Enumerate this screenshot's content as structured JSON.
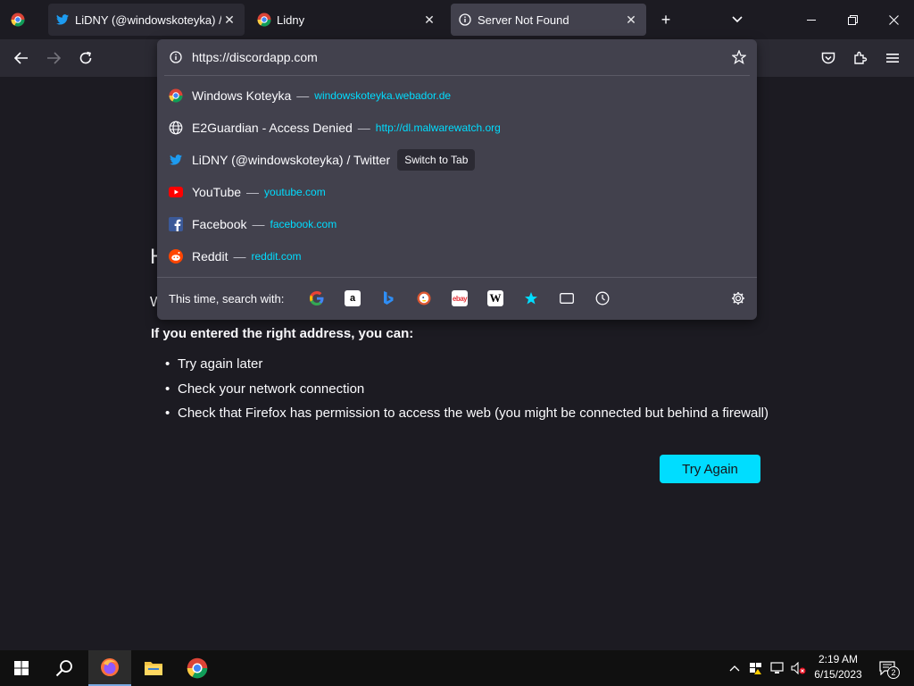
{
  "tabs": [
    {
      "title": "LiDNY (@windowskoteyka) / Twitter",
      "display": "LiDNY (@windowskoteyka) / Tw"
    },
    {
      "title": "Lidny"
    },
    {
      "title": "Server Not Found"
    }
  ],
  "urlbar": {
    "value": "https://discordapp.com"
  },
  "results": [
    {
      "title": "Windows Koteyka",
      "sep": "—",
      "url": "windowskoteyka.webador.de",
      "icon": "chrome-icon"
    },
    {
      "title": "E2Guardian - Access Denied",
      "sep": "—",
      "url": "http://dl.malwarewatch.org",
      "icon": "globe-icon"
    },
    {
      "title": "LiDNY (@windowskoteyka) / Twitter",
      "action": "Switch to Tab",
      "icon": "twitter-icon"
    },
    {
      "title": "YouTube",
      "sep": "—",
      "url": "youtube.com",
      "icon": "youtube-icon"
    },
    {
      "title": "Facebook",
      "sep": "—",
      "url": "facebook.com",
      "icon": "facebook-icon"
    },
    {
      "title": "Reddit",
      "sep": "—",
      "url": "reddit.com",
      "icon": "reddit-icon"
    }
  ],
  "search_with": {
    "label": "This time, search with:",
    "engines": [
      "google-icon",
      "amazon-icon",
      "bing-icon",
      "duckduckgo-icon",
      "ebay-icon",
      "wikipedia-icon",
      "bookmarks-icon",
      "tabs-icon",
      "history-icon"
    ]
  },
  "page": {
    "heading_fragment": "H",
    "para_fragment": "W",
    "entered": "If you entered the right address, you can:",
    "items": [
      "Try again later",
      "Check your network connection",
      "Check that Firefox has permission to access the web (you might be connected but behind a firewall)"
    ],
    "try_again": "Try Again"
  },
  "clock": {
    "time": "2:19 AM",
    "date": "6/15/2023"
  },
  "notifications": {
    "count": "2"
  },
  "colors": {
    "accent": "#00ddff",
    "bg": "#1c1b22",
    "toolbar": "#2b2a33",
    "popup": "#42414d"
  }
}
